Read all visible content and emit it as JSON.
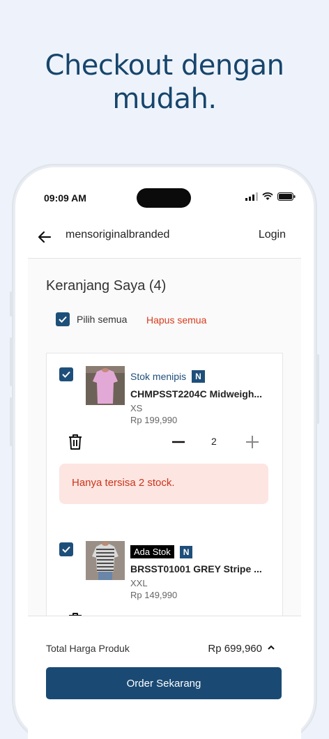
{
  "headline": {
    "line1": "Checkout dengan",
    "line2": "mudah."
  },
  "status_bar": {
    "time": "09:09 AM",
    "icons": [
      "signal-icon",
      "wifi-icon",
      "battery-icon"
    ]
  },
  "topbar": {
    "store_name": "mensoriginalbranded",
    "login_label": "Login"
  },
  "cart": {
    "title": "Keranjang Saya (4)",
    "select_all_label": "Pilih semua",
    "delete_all_label": "Hapus semua",
    "items": [
      {
        "stock_label": "Stok menipis",
        "badge": "N",
        "name": "CHMPSST2204C Midweigh...",
        "size": "XS",
        "price": "Rp 199,990",
        "quantity": "2",
        "alert": "Hanya tersisa 2 stock.",
        "checked": true
      },
      {
        "stock_label": "Ada Stok",
        "badge": "N",
        "name": "BRSST01001 GREY Stripe ...",
        "size": "XXL",
        "price": "Rp 149,990",
        "checked": true
      }
    ]
  },
  "summary": {
    "total_label": "Total Harga Produk",
    "total_value": "Rp 699,960"
  },
  "order_button": "Order Sekarang",
  "colors": {
    "brand": "#1a4a74",
    "danger": "#d73a1c",
    "alert_bg": "#fde5e1",
    "page_bg": "#eef3fb"
  }
}
